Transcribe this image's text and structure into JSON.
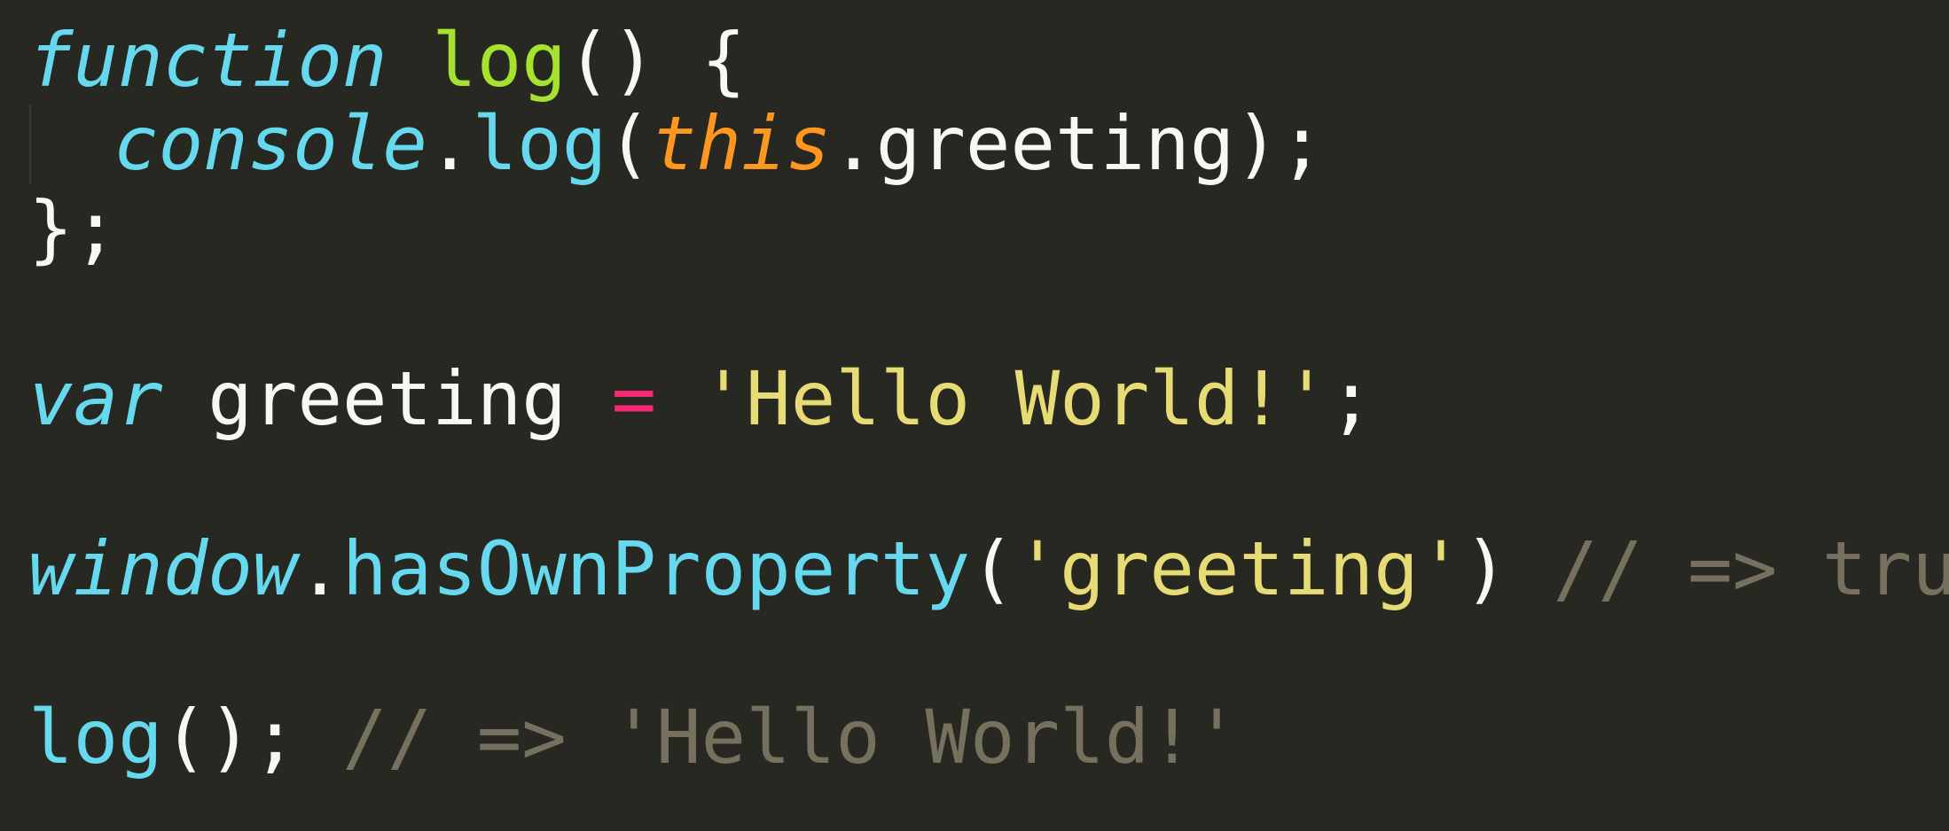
{
  "editor": {
    "theme_colors": {
      "background": "#272822",
      "plain": "#f8f8f2",
      "storage_keyword": "#66d9ef",
      "function_name": "#a6e22e",
      "this_keyword": "#fd971f",
      "operator": "#f92672",
      "string": "#e6db74",
      "comment": "#75715e"
    },
    "code": {
      "line1": {
        "keyword": "function",
        "space1": " ",
        "name": "log",
        "parens": "()",
        "space2": " ",
        "brace": "{"
      },
      "line2": {
        "object": "console",
        "dot1": ".",
        "method": "log",
        "open": "(",
        "this_kw": "this",
        "dot2": ".",
        "prop": "greeting",
        "close": ");"
      },
      "line3": {
        "text": "};"
      },
      "line5": {
        "keyword": "var",
        "space1": " ",
        "name": "greeting",
        "space2": " ",
        "operator": "=",
        "space3": " ",
        "string": "'Hello World!'",
        "semicolon": ";"
      },
      "line7": {
        "object": "window",
        "dot": ".",
        "method": "hasOwnProperty",
        "open": "(",
        "string": "'greeting'",
        "close": ")",
        "space": " ",
        "comment": "// => true"
      },
      "line9": {
        "call": "log",
        "parens": "();",
        "space": " ",
        "comment": "// => 'Hello World!'"
      }
    }
  }
}
